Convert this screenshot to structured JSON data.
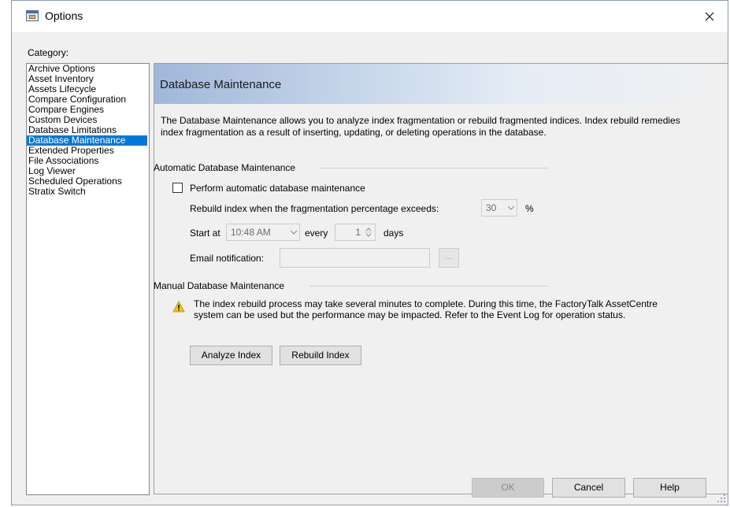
{
  "window": {
    "title": "Options"
  },
  "category": {
    "label": "Category:",
    "items": [
      "Archive Options",
      "Asset Inventory",
      "Assets Lifecycle",
      "Compare Configuration",
      "Compare Engines",
      "Custom Devices",
      "Database Limitations",
      "Database Maintenance",
      "Extended Properties",
      "File Associations",
      "Log Viewer",
      "Scheduled Operations",
      "Stratix Switch"
    ],
    "selected": "Database Maintenance"
  },
  "panel": {
    "title": "Database Maintenance",
    "description": "The Database Maintenance allows you to analyze index fragmentation or rebuild fragmented indices. Index rebuild remedies index fragmentation as a result of inserting, updating, or deleting operations in the database."
  },
  "automatic": {
    "group_title": "Automatic Database Maintenance",
    "checkbox_label": "Perform automatic database maintenance",
    "checked": false,
    "rebuild_label": "Rebuild index when the fragmentation percentage exceeds:",
    "percentage_value": "30",
    "percent_sign": "%",
    "start_at_label": "Start at",
    "start_time": "10:48 AM",
    "every_label": "every",
    "every_value": "1",
    "days_label": "days",
    "email_label": "Email notification:",
    "email_value": "",
    "browse_label": "..."
  },
  "manual": {
    "group_title": "Manual Database Maintenance",
    "warning": "The index rebuild process may take several minutes to complete. During this time, the FactoryTalk AssetCentre system can be used but the performance may be impacted. Refer to the Event Log for operation status.",
    "analyze_label": "Analyze Index",
    "rebuild_label": "Rebuild Index"
  },
  "footer": {
    "ok_label": "OK",
    "cancel_label": "Cancel",
    "help_label": "Help"
  },
  "colors": {
    "selection": "#0078d7",
    "warning": "#f5c518"
  }
}
